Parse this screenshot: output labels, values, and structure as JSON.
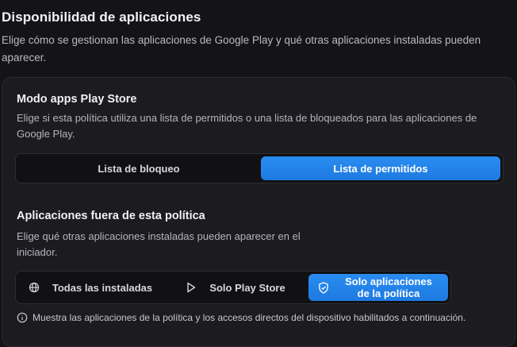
{
  "header": {
    "title": "Disponibilidad de aplicaciones",
    "subtitle": "Elige cómo se gestionan las aplicaciones de Google Play y qué otras aplicaciones instaladas pueden aparecer."
  },
  "play_store_mode": {
    "title": "Modo apps Play Store",
    "description": "Elige si esta política utiliza una lista de permitidos o una lista de bloqueados para las aplicaciones de Google Play.",
    "options": [
      {
        "label": "Lista de bloqueo",
        "selected": false
      },
      {
        "label": "Lista de permitidos",
        "selected": true
      }
    ]
  },
  "outside_apps": {
    "title": "Aplicaciones fuera de esta política",
    "description": "Elige qué otras aplicaciones instaladas pueden aparecer en el iniciador.",
    "options": [
      {
        "label": "Todas las instaladas",
        "icon": "globe-icon",
        "selected": false
      },
      {
        "label": "Solo Play Store",
        "icon": "play-icon",
        "selected": false
      },
      {
        "label": "Solo aplicaciones de la política",
        "icon": "shield-icon",
        "selected": true
      }
    ],
    "note": "Muestra las aplicaciones de la política y los accesos directos del dispositivo habilitados a continuación.",
    "note_icon": "info-icon"
  },
  "colors": {
    "background": "#141416",
    "card": "#1c1c20",
    "accent": "#1f80e6"
  }
}
